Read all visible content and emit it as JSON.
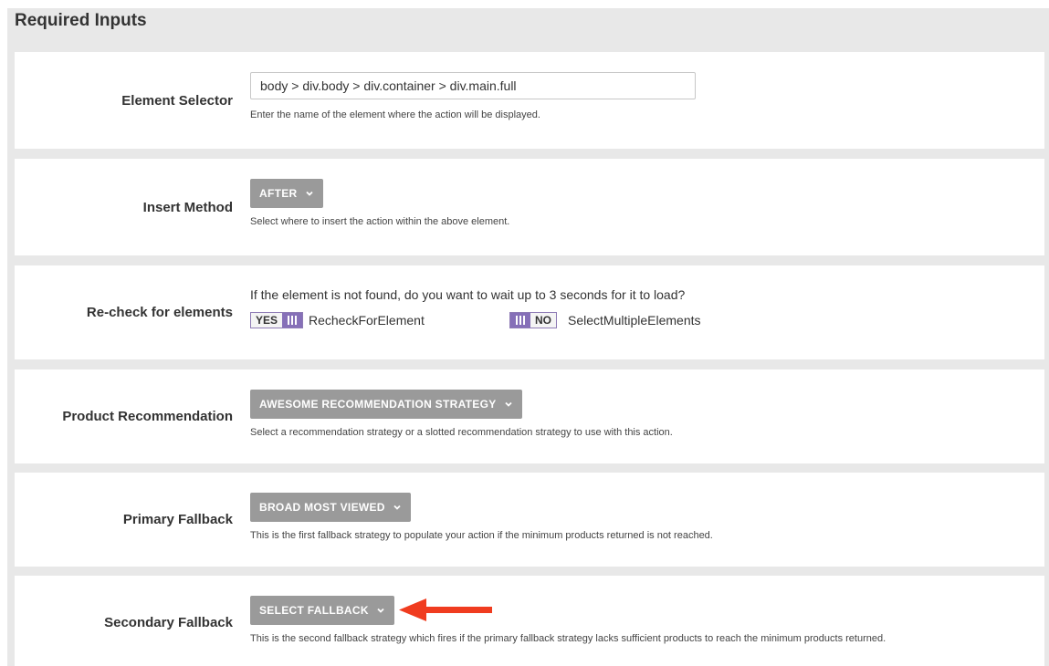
{
  "panel": {
    "title": "Required Inputs"
  },
  "element_selector": {
    "label": "Element Selector",
    "value": "body > div.body > div.container > div.main.full",
    "help": "Enter the name of the element where the action will be displayed."
  },
  "insert_method": {
    "label": "Insert Method",
    "value": "AFTER",
    "help": "Select where to insert the action within the above element."
  },
  "recheck": {
    "label": "Re-check for elements",
    "question": "If the element is not found, do you want to wait up to 3 seconds for it to load?",
    "toggle1": {
      "state": "YES",
      "name": "RecheckForElement"
    },
    "toggle2": {
      "state": "NO",
      "name": "SelectMultipleElements"
    }
  },
  "product_recommendation": {
    "label": "Product Recommendation",
    "value": "AWESOME RECOMMENDATION STRATEGY",
    "help": "Select a recommendation strategy or a slotted recommendation strategy to use with this action."
  },
  "primary_fallback": {
    "label": "Primary Fallback",
    "value": "BROAD MOST VIEWED",
    "help": "This is the first fallback strategy to populate your action if the minimum products returned is not reached."
  },
  "secondary_fallback": {
    "label": "Secondary Fallback",
    "value": "SELECT FALLBACK",
    "help": "This is the second fallback strategy which fires if the primary fallback strategy lacks sufficient products to reach the minimum products returned."
  },
  "colors": {
    "panel_bg": "#e8e8e8",
    "dropdown_bg": "#9a9a9a",
    "toggle_accent": "#8670b8",
    "annotation_arrow": "#f03c1f"
  },
  "icons": {
    "dropdown": "chevron-down-icon",
    "toggle_grip": "grip-lines-icon",
    "annotation": "arrow-left-icon"
  }
}
